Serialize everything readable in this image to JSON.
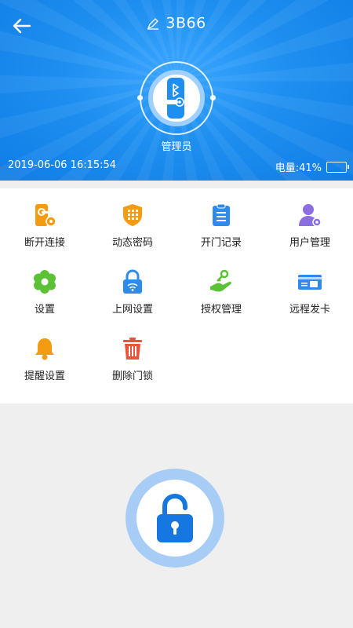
{
  "header": {
    "title": "3B66",
    "role": "管理员",
    "datetime": "2019-06-06 16:15:54",
    "battery_label": "电量:41%",
    "battery_level": 0.41
  },
  "menu": [
    {
      "label": "断开连接",
      "icon": "disconnect-icon"
    },
    {
      "label": "动态密码",
      "icon": "dynamic-password-icon"
    },
    {
      "label": "开门记录",
      "icon": "record-icon"
    },
    {
      "label": "用户管理",
      "icon": "user-management-icon"
    },
    {
      "label": "设置",
      "icon": "settings-icon"
    },
    {
      "label": "上网设置",
      "icon": "network-settings-icon"
    },
    {
      "label": "授权管理",
      "icon": "authorization-icon"
    },
    {
      "label": "远程发卡",
      "icon": "remote-card-icon"
    },
    {
      "label": "提醒设置",
      "icon": "reminder-icon"
    },
    {
      "label": "删除门锁",
      "icon": "delete-lock-icon"
    }
  ],
  "colors": {
    "header_blue": "#1e8ff0",
    "orange": "#f39c12",
    "blue": "#2f8bea",
    "green": "#5bc236",
    "purple": "#8b6fe0",
    "red": "#e8533a"
  }
}
